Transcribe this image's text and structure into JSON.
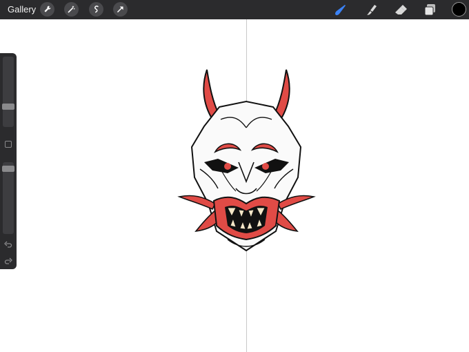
{
  "toolbar": {
    "gallery_label": "Gallery",
    "left_tools": [
      {
        "icon": "wrench-icon"
      },
      {
        "icon": "magic-wand-icon"
      },
      {
        "icon": "selection-icon"
      },
      {
        "icon": "transform-arrow-icon"
      }
    ],
    "right_tools": [
      {
        "icon": "brush-icon",
        "active": true
      },
      {
        "icon": "smudge-icon"
      },
      {
        "icon": "eraser-icon"
      },
      {
        "icon": "layers-icon"
      }
    ],
    "current_color": "#000000",
    "active_color": "#3b82f6"
  },
  "sidebar": {
    "brush_size_level": 0.73,
    "opacity_level": 0.05
  },
  "artwork": {
    "subject": "oni-mask-icon",
    "colors": {
      "red": "#e04b46",
      "outline": "#111111",
      "face": "#ffffff"
    }
  }
}
